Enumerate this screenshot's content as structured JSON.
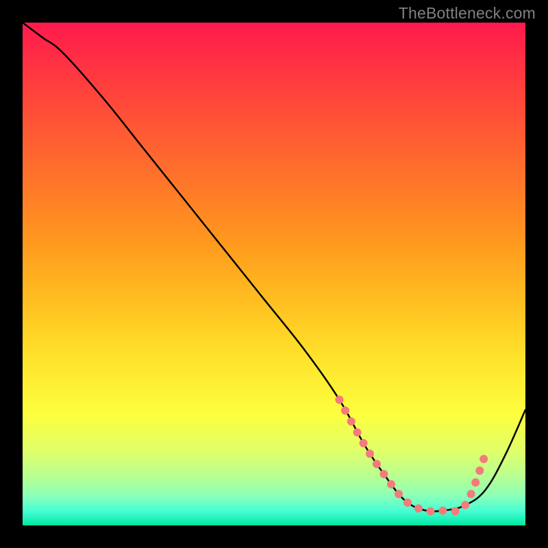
{
  "watermark": "TheBottleneck.com",
  "chart_data": {
    "type": "line",
    "title": "",
    "xlabel": "",
    "ylabel": "",
    "xlim": [
      0,
      100
    ],
    "ylim": [
      0,
      100
    ],
    "grid": false,
    "legend": false,
    "description": "Bottleneck curve over a vertical red-to-green gradient background. Black curve descends from top-left, flattens near bottom around x≈70–90, then rises. Dotted coral marker highlights the flat-bottom valley segment.",
    "series": [
      {
        "name": "bottleneck-curve",
        "color": "#000000",
        "x": [
          0,
          4,
          8,
          16,
          24,
          32,
          40,
          48,
          56,
          63,
          68,
          72,
          76,
          80,
          84,
          88,
          92,
          96,
          100
        ],
        "y": [
          100,
          97,
          94,
          85,
          75,
          65,
          55,
          45,
          35,
          25,
          16,
          10,
          5,
          3,
          3,
          4,
          7,
          14,
          23
        ]
      },
      {
        "name": "valley-highlight",
        "color": "#f47b7b",
        "style": "dotted",
        "x": [
          63,
          68,
          72,
          76,
          80,
          84,
          88,
          92
        ],
        "y": [
          25,
          16,
          10,
          5,
          3,
          3,
          4,
          14
        ]
      }
    ],
    "background_gradient": {
      "direction": "top-to-bottom",
      "stops": [
        {
          "pos": 0.0,
          "color": "#ff1a4d"
        },
        {
          "pos": 0.33,
          "color": "#ff7928"
        },
        {
          "pos": 0.66,
          "color": "#ffe12a"
        },
        {
          "pos": 0.9,
          "color": "#baff8f"
        },
        {
          "pos": 1.0,
          "color": "#00e8a5"
        }
      ]
    }
  }
}
